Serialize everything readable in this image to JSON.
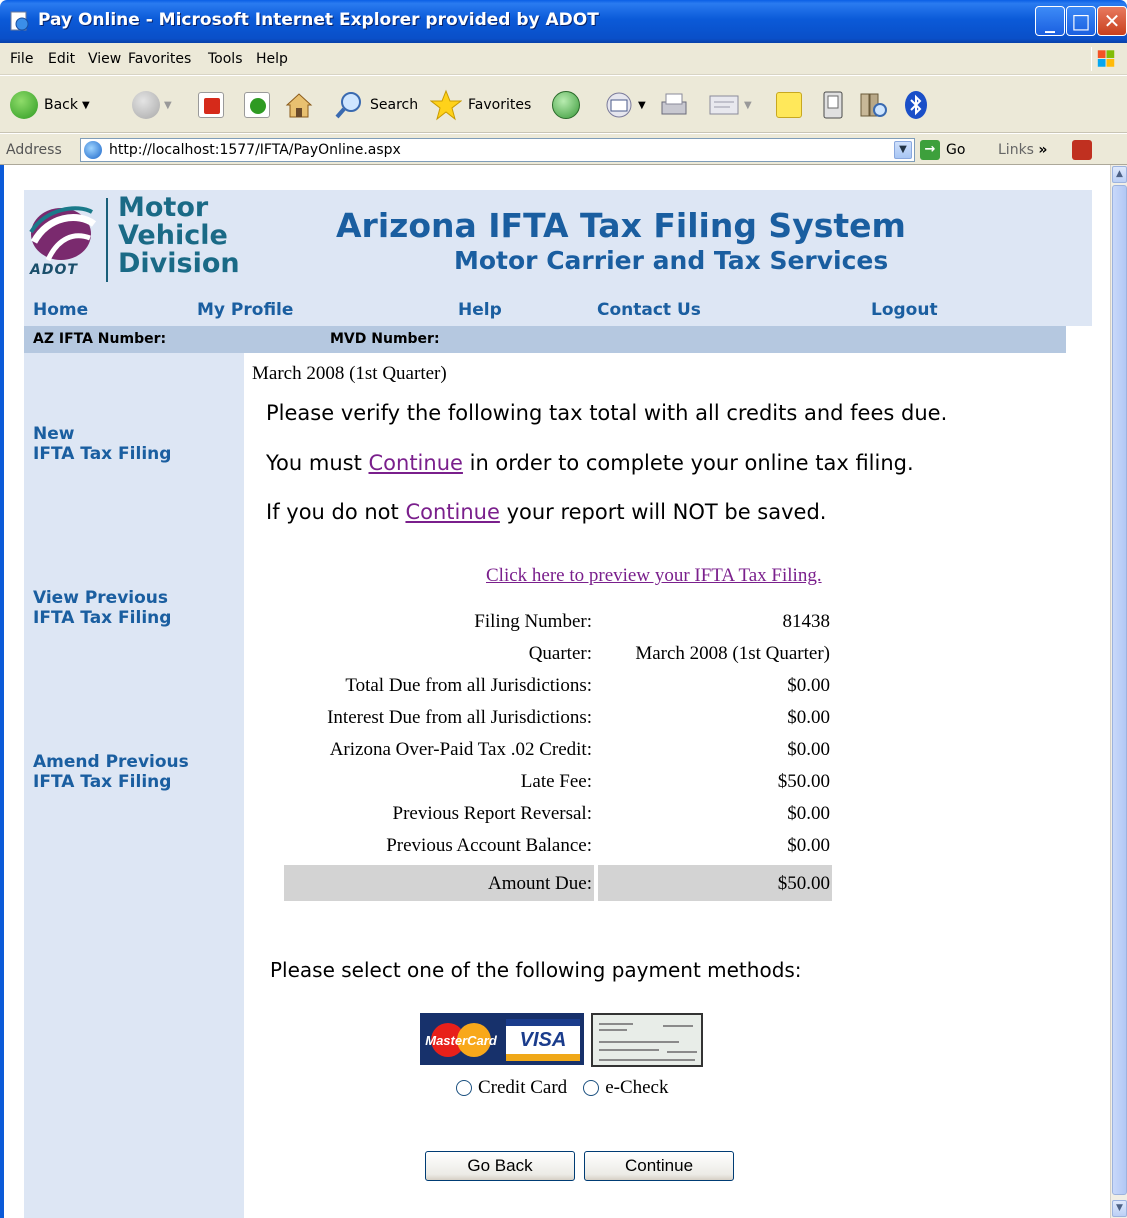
{
  "window": {
    "title": "Pay Online - Microsoft Internet Explorer provided by ADOT"
  },
  "menu": [
    "File",
    "Edit",
    "View",
    "Favorites",
    "Tools",
    "Help"
  ],
  "toolbar": {
    "back_label": "Back",
    "search_label": "Search",
    "favorites_label": "Favorites"
  },
  "address": {
    "label": "Address",
    "url": "http://localhost:1577/IFTA/PayOnline.aspx",
    "go_label": "Go",
    "links_label": "Links"
  },
  "header": {
    "logo_line1": "Motor",
    "logo_line2": "Vehicle",
    "logo_line3": "Division",
    "logo_small": "ADOT",
    "title": "Arizona IFTA Tax Filing System",
    "subtitle": "Motor Carrier and Tax Services"
  },
  "nav": [
    "Home",
    "My Profile",
    "Help",
    "Contact Us",
    "Logout"
  ],
  "info": {
    "ifta_label": "AZ IFTA Number:",
    "mvd_label": "MVD Number:"
  },
  "sidebar": [
    {
      "line1": "New",
      "line2": "IFTA Tax Filing"
    },
    {
      "line1": "View Previous",
      "line2": "IFTA Tax Filing"
    },
    {
      "line1": "Amend Previous",
      "line2": "IFTA Tax Filing"
    }
  ],
  "content": {
    "period": "March 2008 (1st Quarter)",
    "msg1": "Please verify the following tax total with all credits and fees due.",
    "msg2_pre": "You must ",
    "msg2_link": "Continue",
    "msg2_post": " in order to complete your online tax filing.",
    "msg3_pre": "If you do not ",
    "msg3_link": "Continue",
    "msg3_post": " your report will NOT be saved.",
    "preview_link": "Click here to preview your IFTA Tax Filing.",
    "summary": [
      {
        "label": "Filing Number:",
        "value": "81438"
      },
      {
        "label": "Quarter:",
        "value": "March 2008 (1st Quarter)"
      },
      {
        "label": "Total Due from all Jurisdictions:",
        "value": "$0.00"
      },
      {
        "label": "Interest Due from all Jurisdictions:",
        "value": "$0.00"
      },
      {
        "label": "Arizona Over-Paid Tax .02 Credit:",
        "value": "$0.00"
      },
      {
        "label": "Late Fee:",
        "value": "$50.00"
      },
      {
        "label": "Previous Report Reversal:",
        "value": "$0.00"
      },
      {
        "label": "Previous Account Balance:",
        "value": "$0.00"
      }
    ],
    "amount_due_label": "Amount Due:",
    "amount_due_value": "$50.00",
    "payment_prompt": "Please select one of the following payment methods:",
    "mastercard_text": "MasterCard",
    "visa_text": "VISA",
    "opt_credit": "Credit Card",
    "opt_echeck": "e-Check",
    "back_button": "Go Back",
    "continue_button": "Continue"
  },
  "colors": {
    "nav_text": "#1a5ea0",
    "header_bg": "#dde6f4",
    "infobar_bg": "#b5c8e0",
    "link_visited": "#7a1f8c"
  }
}
